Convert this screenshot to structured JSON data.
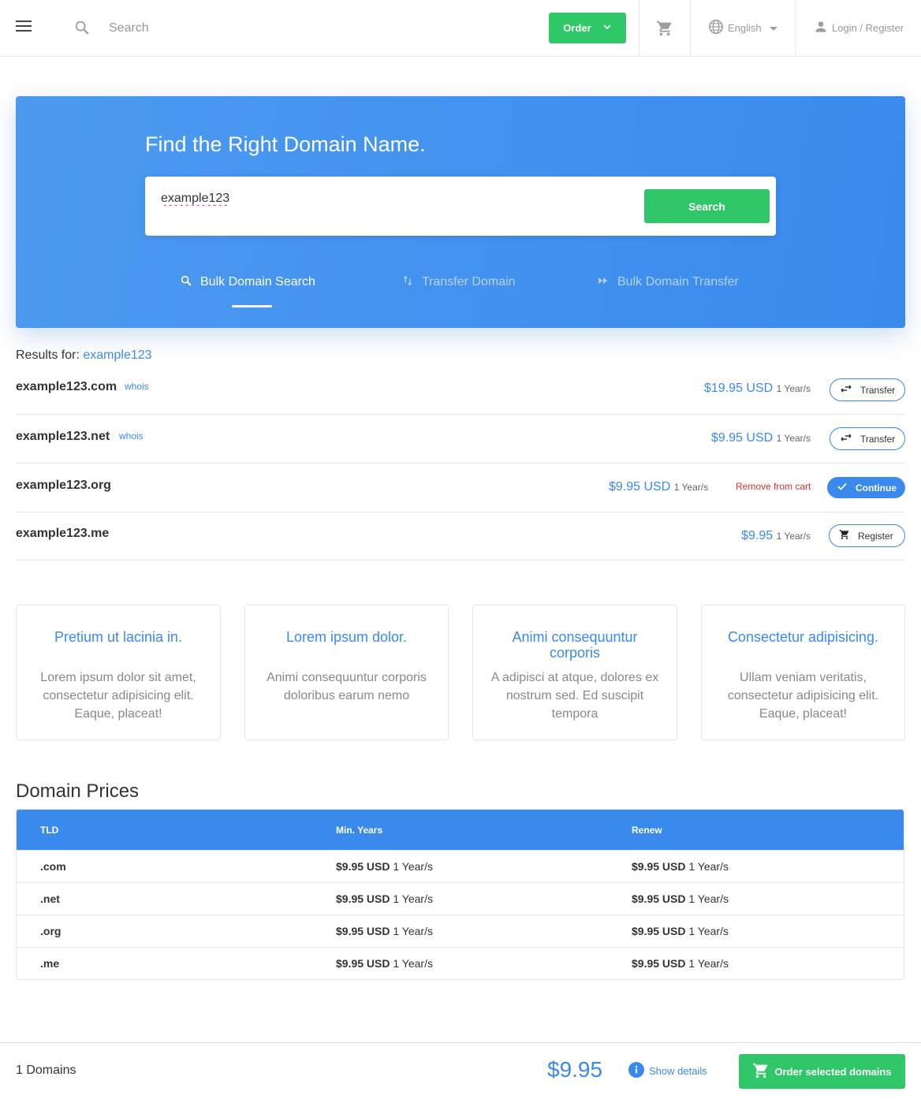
{
  "header": {
    "search_placeholder": "Search",
    "order_label": "Order",
    "language": "English",
    "login_label": "Login / Register"
  },
  "hero": {
    "title": "Find the Right Domain Name.",
    "query": "example123",
    "search_label": "Search",
    "tabs": [
      {
        "label": "Bulk Domain Search",
        "active": true,
        "icon": "search-icon"
      },
      {
        "label": "Transfer Domain",
        "active": false,
        "icon": "transfer-arrows-icon"
      },
      {
        "label": "Bulk Domain Transfer",
        "active": false,
        "icon": "fast-forward-icon"
      }
    ]
  },
  "results": {
    "prefix": "Results for:",
    "query": "example123",
    "rows": [
      {
        "domain": "example123.com",
        "whois": "whois",
        "price": "$19.95 USD",
        "years": "1 Year/s",
        "action": "Transfer",
        "action_icon": "transfer-icon"
      },
      {
        "domain": "example123.net",
        "whois": "whois",
        "price": "$9.95 USD",
        "years": "1 Year/s",
        "action": "Transfer",
        "action_icon": "transfer-icon"
      },
      {
        "domain": "example123.org",
        "price": "$9.95 USD",
        "years": "1 Year/s",
        "remove": "Remove from cart",
        "action": "Continue",
        "action_icon": "check-icon"
      },
      {
        "domain": "example123.me",
        "price": "$9.95",
        "years": "1 Year/s",
        "action": "Register",
        "action_icon": "cart-icon"
      }
    ]
  },
  "features": [
    {
      "title": "Pretium ut lacinia in.",
      "body": "Lorem ipsum dolor sit amet, consectetur adipisicing elit. Eaque, placeat!"
    },
    {
      "title": "Lorem ipsum dolor.",
      "body": "Animi consequuntur corporis doloribus earum nemo"
    },
    {
      "title": "Animi consequuntur corporis",
      "body": "A adipisci at atque, dolores ex nostrum sed. Ed suscipit tempora"
    },
    {
      "title": "Consectetur adipisicing.",
      "body": "Ullam veniam veritatis, consectetur adipisicing elit. Eaque, placeat!"
    }
  ],
  "prices": {
    "title": "Domain Prices",
    "columns": [
      "TLD",
      "Min. Years",
      "Renew"
    ],
    "rows": [
      {
        "tld": ".com",
        "min_price": "$9.95 USD",
        "min_years": "1 Year/s",
        "renew_price": "$9.95 USD",
        "renew_years": "1 Year/s"
      },
      {
        "tld": ".net",
        "min_price": "$9.95 USD",
        "min_years": "1 Year/s",
        "renew_price": "$9.95 USD",
        "renew_years": "1 Year/s"
      },
      {
        "tld": ".org",
        "min_price": "$9.95 USD",
        "min_years": "1 Year/s",
        "renew_price": "$9.95 USD",
        "renew_years": "1 Year/s"
      },
      {
        "tld": ".me",
        "min_price": "$9.95 USD",
        "min_years": "1 Year/s",
        "renew_price": "$9.95 USD",
        "renew_years": "1 Year/s"
      }
    ]
  },
  "bottom": {
    "count": "1 Domains",
    "total": "$9.95",
    "details_label": "Show details",
    "order_label": "Order selected domains"
  },
  "colors": {
    "accent_blue": "#3a8aee",
    "green": "#2fc767",
    "danger": "#d32f2f"
  }
}
